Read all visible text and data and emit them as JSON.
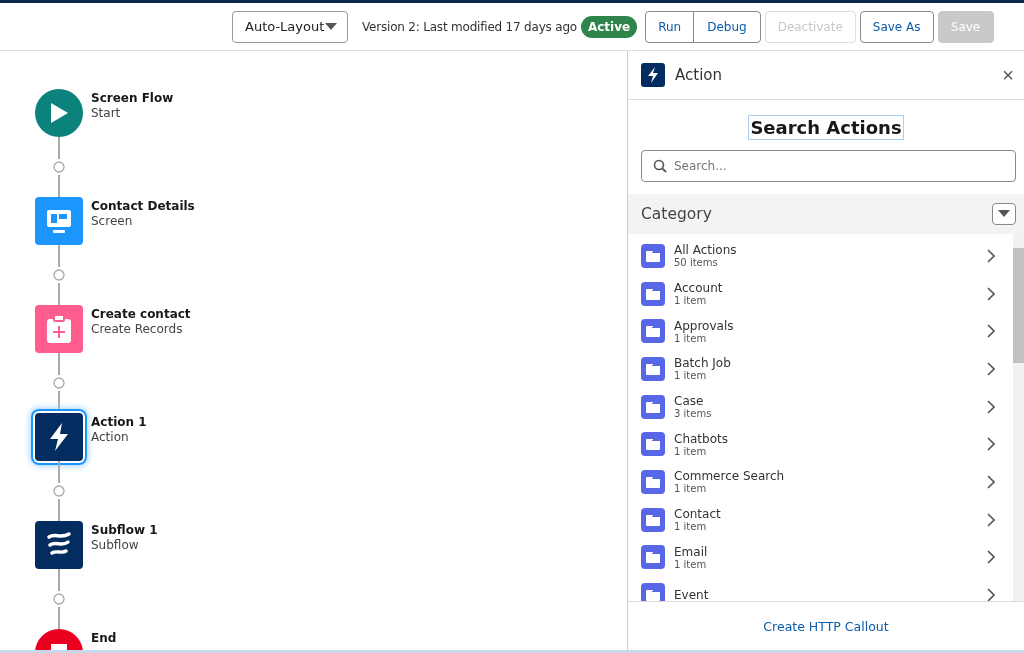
{
  "toolbar": {
    "layout_dropdown": "Auto-Layout",
    "version_info": "Version 2: Last modified 17 days ago",
    "status_badge": "Active",
    "buttons": [
      {
        "label": "Run",
        "disabled": false,
        "group": true
      },
      {
        "label": "Debug",
        "disabled": false,
        "group": true
      },
      {
        "label": "Deactivate",
        "disabled": true,
        "group": false
      },
      {
        "label": "Save As",
        "disabled": false,
        "group": false
      },
      {
        "label": "Save",
        "disabled": true,
        "group": false
      }
    ]
  },
  "flow": {
    "nodes": [
      {
        "kind": "start",
        "title": "Screen Flow",
        "subtitle": "Start",
        "selected": false
      },
      {
        "kind": "screen",
        "title": "Contact Details",
        "subtitle": "Screen",
        "selected": false
      },
      {
        "kind": "create",
        "title": "Create contact",
        "subtitle": "Create Records",
        "selected": false
      },
      {
        "kind": "action",
        "title": "Action 1",
        "subtitle": "Action",
        "selected": true
      },
      {
        "kind": "subflow",
        "title": "Subflow 1",
        "subtitle": "Subflow",
        "selected": false
      },
      {
        "kind": "end",
        "title": "End",
        "selected": false
      }
    ]
  },
  "panel": {
    "title": "Action",
    "close": "×",
    "heading": "Search Actions",
    "search": {
      "placeholder": "Search..."
    },
    "category_label": "Category",
    "categories": [
      {
        "name": "All Actions",
        "count": "50 items"
      },
      {
        "name": "Account",
        "count": "1 item"
      },
      {
        "name": "Approvals",
        "count": "1 item"
      },
      {
        "name": "Batch Job",
        "count": "1 item"
      },
      {
        "name": "Case",
        "count": "3 items"
      },
      {
        "name": "Chatbots",
        "count": "1 item"
      },
      {
        "name": "Commerce Search",
        "count": "1 item"
      },
      {
        "name": "Contact",
        "count": "1 item"
      },
      {
        "name": "Email",
        "count": "1 item"
      },
      {
        "name": "Event"
      }
    ],
    "footer_link": "Create HTTP Callout"
  }
}
